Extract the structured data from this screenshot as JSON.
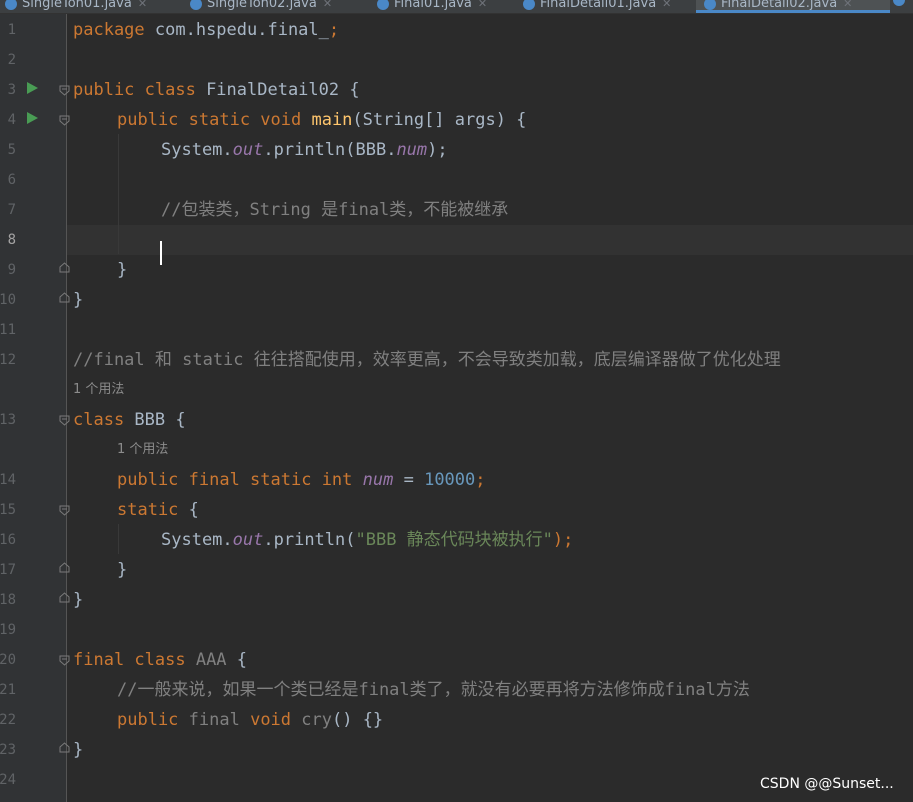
{
  "tabs": [
    {
      "label": "SingleTon01.java"
    },
    {
      "label": "SingleTon02.java"
    },
    {
      "label": "Final01.java"
    },
    {
      "label": "FinalDetail01.java"
    },
    {
      "label": "FinalDetail02.java",
      "active": true
    }
  ],
  "editor": {
    "line_numbers": [
      "1",
      "2",
      "3",
      "4",
      "5",
      "6",
      "7",
      "8",
      "9",
      "10",
      "11",
      "12",
      "13",
      "14",
      "15",
      "16",
      "17",
      "18",
      "19",
      "20",
      "21",
      "22",
      "23",
      "24"
    ],
    "current_line": "8",
    "code": {
      "l1": {
        "a": "package ",
        "b": "com.hspedu.final_",
        ";": ";"
      },
      "l3": {
        "a": "public class ",
        "b": "FinalDetail02 {"
      },
      "l4": {
        "a": "public static void ",
        "b": "main",
        "c": "(String[] args) {"
      },
      "l5": {
        "a": "System.",
        "b": "out",
        "c": ".println(BBB.",
        "d": "num",
        "e": ");"
      },
      "l7": {
        "a": "//包装类，String 是final类，不能被继承"
      },
      "l9": {
        "a": "}"
      },
      "l10": {
        "a": "}"
      },
      "l12": {
        "a": "//final 和 static 往往搭配使用，效率更高，不会导致类加载，底层编译器做了优化处理"
      },
      "hint1": "1 个用法",
      "l13": {
        "a": "class ",
        "b": "BBB {"
      },
      "hint2": "1 个用法",
      "l14": {
        "a": "public final static int ",
        "b": "num",
        " = ": " = ",
        "c": "10000",
        ";": ";"
      },
      "l15": {
        "a": "static ",
        "b": "{"
      },
      "l16": {
        "a": "System.",
        "b": "out",
        "c": ".println(",
        "d": "\"BBB 静态代码块被执行\"",
        "e": ");"
      },
      "l17": {
        "a": "}"
      },
      "l18": {
        "a": "}"
      },
      "l20": {
        "a": "final class ",
        "b": "AAA",
        " {": " {"
      },
      "l21": {
        "a": "//一般来说，如果一个类已经是final类了，就没有必要再将方法修饰成final方法"
      },
      "l22": {
        "a": "public ",
        "b": "final ",
        "c": "void ",
        "d": "cry",
        "e": "() {}"
      },
      "l23": {
        "a": "}"
      }
    }
  },
  "watermark": "CSDN @@Sunset...",
  "colors": {
    "background": "#2b2b2b",
    "keyword": "#cc7832",
    "method": "#ffc66d",
    "static_field": "#9876aa",
    "number": "#6897bb",
    "string": "#6a8759",
    "comment": "#808080"
  }
}
